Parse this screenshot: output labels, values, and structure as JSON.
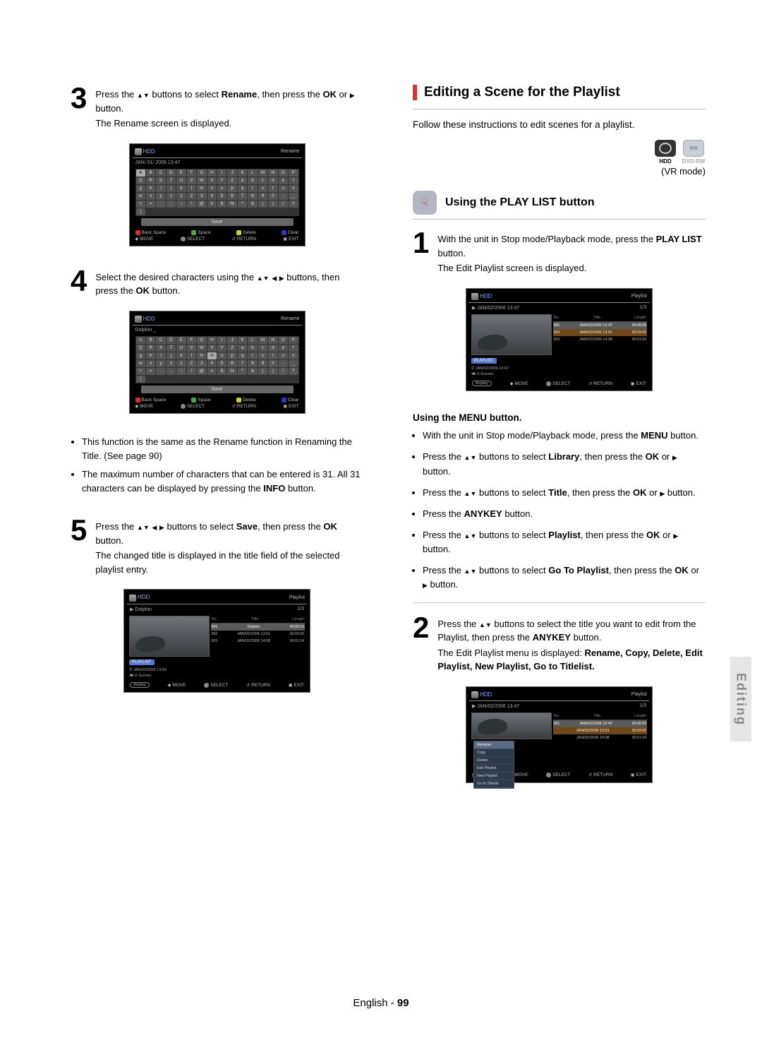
{
  "left": {
    "step3": {
      "num": "3",
      "l1a": "Press the ",
      "l1b": " buttons to select ",
      "l1bold": "Rename",
      "l1c": ", then press the ",
      "l1bold2": "OK",
      "l1d": " or ",
      "l1e": " button.",
      "l2": "The Rename screen is displayed."
    },
    "osd1": {
      "hdd": "HDD",
      "mode": "Rename",
      "date": "JAN/ 01/ 2006   13:47",
      "save": "Save",
      "foot1": {
        "back": "Back Space",
        "space": "Space",
        "delete": "Delete",
        "clear": "Clear"
      },
      "foot2": {
        "move": "MOVE",
        "select": "SELECT",
        "return": "RETURN",
        "exit": "EXIT"
      },
      "keys": [
        "A",
        "B",
        "C",
        "D",
        "E",
        "F",
        "G",
        "H",
        "I",
        "J",
        "K",
        "L",
        "M",
        "N",
        "O",
        "P",
        "Q",
        "R",
        "S",
        "T",
        "U",
        "V",
        "W",
        "X",
        "Y",
        "Z",
        "a",
        "b",
        "c",
        "d",
        "e",
        "f",
        "g",
        "h",
        "i",
        "j",
        "k",
        "l",
        "m",
        "n",
        "o",
        "p",
        "q",
        "r",
        "s",
        "t",
        "u",
        "v",
        "w",
        "x",
        "y",
        "z",
        "1",
        "2",
        "3",
        "4",
        "5",
        "6",
        "7",
        "8",
        "9",
        "0",
        "-",
        "_",
        "+",
        "=",
        ".",
        ",",
        "~",
        "!",
        "@",
        "#",
        "$",
        "%",
        "^",
        "&",
        "(",
        ")",
        "/",
        "?",
        "|"
      ],
      "sel": "A"
    },
    "step4": {
      "num": "4",
      "l1a": "Select the desired characters using the ",
      "l1b": " buttons, then press the ",
      "l1bold": "OK",
      "l1c": " button."
    },
    "osd2": {
      "hdd": "HDD",
      "mode": "Rename",
      "date": "Dolphin _",
      "save": "Save",
      "sel": "n"
    },
    "notes": [
      "This function is the same as the Rename function in Renaming the Title. (See page 90)",
      "The maximum number of characters that can be entered is 31. All 31 characters can be displayed by pressing the INFO button."
    ],
    "notes_bold": "INFO",
    "step5": {
      "num": "5",
      "l1a": "Press the ",
      "l1b": " buttons to select ",
      "l1bold": "Save",
      "l1c": ", then press the ",
      "l1bold2": "OK",
      "l1d": " button.",
      "l2": "The changed title is displayed in the title field of the selected playlist entry."
    },
    "osd3": {
      "hdd": "HDD",
      "mode": "Playlist",
      "count": "1/3",
      "date": "Dolphin",
      "tag": "PLAYLIST",
      "meta1": "JAN/02/2006 13:50",
      "meta2": "6 Scenes",
      "head": {
        "no": "No.",
        "title": "Title",
        "len": "Length"
      },
      "rows": [
        {
          "no": "001",
          "title": "Dolphin",
          "len": "00:00:15"
        },
        {
          "no": "002",
          "title": "JAN/02/2006 13:51",
          "len": "00:03:00"
        },
        {
          "no": "003",
          "title": "JAN/02/2006 14:08",
          "len": "00:01:54"
        }
      ],
      "anykey": "Anykey"
    }
  },
  "right": {
    "heading": "Editing a Scene for the Playlist",
    "intro": "Follow these instructions to edit scenes for a playlist.",
    "media": {
      "hdd": "HDD",
      "dvdrw": "DVD-RW"
    },
    "vr": "(VR mode)",
    "sub_heading": "Using the PLAY LIST button",
    "step1": {
      "num": "1",
      "l1a": "With the unit in Stop mode/Playback mode, press the ",
      "l1bold": "PLAY LIST",
      "l1b": " button.",
      "l2": "The Edit Playlist screen is displayed."
    },
    "osd1": {
      "hdd": "HDD",
      "mode": "Playlist",
      "count": "1/3",
      "date": "JAN/02/2006 13:47",
      "tag": "PLAYLIST",
      "meta1": "JAN/02/2006 13:47",
      "meta2": "6 Scenes",
      "rows": [
        {
          "no": "001",
          "title": "JAN/02/2006 12:47",
          "len": "00:00:09"
        },
        {
          "no": "002",
          "title": "JAN/02/2006 13:51",
          "len": "00:03:00"
        },
        {
          "no": "003",
          "title": "JAN/02/2006 14:08",
          "len": "00:01:54"
        }
      ],
      "anykey": "Anykey"
    },
    "menu_heading": "Using the MENU button.",
    "bullets": {
      "b1a": "With the unit in Stop mode/Playback mode, press the ",
      "b1bold": "MENU",
      "b1b": " button.",
      "b2a": "Press the ",
      "b2b": " buttons to select ",
      "b2bold": "Library",
      "b2c": ", then press the ",
      "b2bold2": "OK",
      "b2d": " or ",
      "b2e": " button.",
      "b3a": "Press the ",
      "b3b": " buttons to select ",
      "b3bold": "Title",
      "b3c": ", then press the ",
      "b4": "Press the ",
      "b4bold": "ANYKEY",
      "b4b": " button.",
      "b5a": "Press the ",
      "b5b": " buttons to select ",
      "b5bold": "Playlist",
      "b5c": ", then press the ",
      "b6a": "Press the ",
      "b6b": " buttons to select ",
      "b6bold": "Go To Playlist",
      "b6c": ", then press the "
    },
    "step2": {
      "num": "2",
      "l1a": "Press the ",
      "l1b": " buttons to select the title you want to edit from the Playlist, then press the ",
      "l1bold": "ANYKEY",
      "l1c": " button.",
      "l2a": "The Edit Playlist menu is displayed: ",
      "l2bold": "Rename, Copy, Delete, Edit Playlist, New Playlist, Go to Titlelist."
    },
    "osd2": {
      "hdd": "HDD",
      "mode": "Playlist",
      "count": "1/3",
      "date": "JAN/02/2006 13:47",
      "rows": [
        {
          "no": "001",
          "title": "JAN/02/2006 12:47",
          "len": "00:00:09"
        },
        {
          "no": "",
          "title": "JAN/02/2006 13:51",
          "len": "00:03:00"
        },
        {
          "no": "",
          "title": "JAN/02/2006 14:08",
          "len": "00:01:54"
        }
      ],
      "menu": [
        "Rename",
        "Copy",
        "Delete",
        "Edit Playlist",
        "New Playlist",
        "Go to Titlelist"
      ],
      "anykey": "Anykey"
    },
    "osd_foot": {
      "move": "MOVE",
      "select": "SELECT",
      "return": "RETURN",
      "exit": "EXIT"
    },
    "osd_head": {
      "no": "No.",
      "title": "Title",
      "len": "Length"
    }
  },
  "side": "Editing",
  "footer": {
    "lang": "English",
    "dash": " - ",
    "num": "99"
  }
}
